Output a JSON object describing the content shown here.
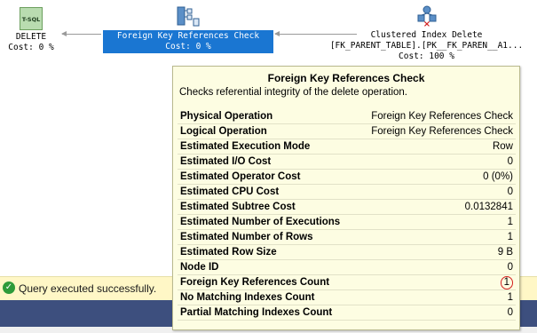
{
  "plan": {
    "delete_node": {
      "label": "DELETE",
      "cost": "Cost: 0 %",
      "icon": "t-sql-icon",
      "icon_text": "T-SQL"
    },
    "fk_node": {
      "label": "Foreign Key References Check",
      "cost": "Cost: 0 %",
      "icon": "foreign-key-check-icon"
    },
    "ci_node": {
      "label": "Clustered Index Delete",
      "object": "[FK_PARENT_TABLE].[PK__FK_PAREN__A1...",
      "cost": "Cost: 100 %",
      "icon": "clustered-index-delete-icon"
    }
  },
  "tooltip": {
    "title": "Foreign Key References Check",
    "description": "Checks referential integrity of the delete operation.",
    "rows": [
      {
        "key": "Physical Operation",
        "value": "Foreign Key References Check"
      },
      {
        "key": "Logical Operation",
        "value": "Foreign Key References Check"
      },
      {
        "key": "Estimated Execution Mode",
        "value": "Row"
      },
      {
        "key": "Estimated I/O Cost",
        "value": "0"
      },
      {
        "key": "Estimated Operator Cost",
        "value": "0 (0%)"
      },
      {
        "key": "Estimated CPU Cost",
        "value": "0"
      },
      {
        "key": "Estimated Subtree Cost",
        "value": "0.0132841"
      },
      {
        "key": "Estimated Number of Executions",
        "value": "1"
      },
      {
        "key": "Estimated Number of Rows",
        "value": "1"
      },
      {
        "key": "Estimated Row Size",
        "value": "9 B"
      },
      {
        "key": "Node ID",
        "value": "0"
      },
      {
        "key": "Foreign Key References Count",
        "value": "1"
      },
      {
        "key": "No Matching Indexes Count",
        "value": "1"
      },
      {
        "key": "Partial Matching Indexes Count",
        "value": "0"
      }
    ]
  },
  "status": {
    "message": "Query executed successfully.",
    "icon": "check-circle-icon"
  },
  "colors": {
    "selection": "#1a76d2",
    "status_bg": "#fff7c6",
    "tooltip_bg": "#fdfde2",
    "success": "#2e9b3a",
    "highlight": "#d42020"
  }
}
